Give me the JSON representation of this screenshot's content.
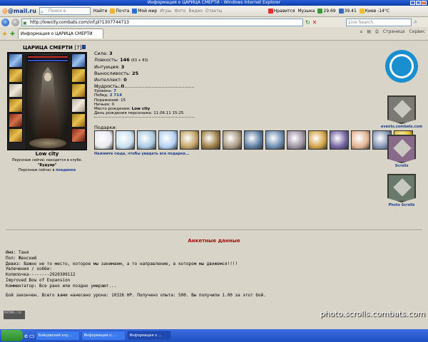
{
  "window": {
    "title": "Информация о ЦАРИЦА СМЕРТИ - Windows Internet Explorer"
  },
  "mail_toolbar": {
    "logo": "@mail.ru",
    "search_placeholder": "Поиск в Интернете",
    "find": "Найти",
    "items": [
      "Почта",
      "Мой мир",
      "Игры",
      "Фото",
      "Видео",
      "Ответы"
    ],
    "likes": "Нравится",
    "music": "Музыка",
    "usd": "29.69",
    "eur": "39.41",
    "weather": "Киев -14°C"
  },
  "nav": {
    "url": "http://lowcity.combats.com/inf.pl?1307744713",
    "live_search_placeholder": "Live Search"
  },
  "tab": {
    "title": "Информация о ЦАРИЦА СМЕРТИ",
    "tools": [
      "Страница",
      "Сервис"
    ]
  },
  "character": {
    "name": "ЦАРИЦА СМЕРТИ",
    "level": "[7]",
    "city": "Low city",
    "location_note": "Персонаж сейчас находится в клубе.",
    "club_room": "\"Будуар\"",
    "fight_prefix": "Персонаж сейчас в",
    "fight_link": "поединке"
  },
  "stats": [
    {
      "label": "Сила:",
      "value": "3",
      "bonus": ""
    },
    {
      "label": "Ловкость:",
      "value": "146",
      "bonus": "(63 + 83)"
    },
    {
      "label": "Интуиция:",
      "value": "3",
      "bonus": ""
    },
    {
      "label": "Выносливость:",
      "value": "25",
      "bonus": ""
    },
    {
      "label": "Интеллект:",
      "value": "0",
      "bonus": ""
    },
    {
      "label": "Мудрость:",
      "value": "0",
      "bonus": ""
    }
  ],
  "details": {
    "level_label": "Уровень:",
    "level": "7",
    "wins_label": "Побед:",
    "wins": "2 714",
    "losses_label": "Поражений:",
    "losses": "15",
    "draws_label": "Ничьих:",
    "draws": "0",
    "birthplace_label": "Место рождения:",
    "birthplace": "Low city",
    "birthday_label": "День рождения персонажа:",
    "birthday": "11.06.11 15:25"
  },
  "gifts": {
    "label": "Подарки:",
    "link": "Нажмите сюда, чтобы увидеть все подарки...",
    "colors": [
      "#e8e8f0",
      "#c8e0f0",
      "#a8c8e0",
      "#b0d0f0",
      "#c0a060",
      "#9a7a40",
      "#a89880",
      "#5a7aa0",
      "#6a8ab0",
      "#9a90a0",
      "#d0a040",
      "#7060a0",
      "#e0b090",
      "#8090b0",
      "#e8c030"
    ]
  },
  "sidebar": {
    "events_label": "events.combats.com",
    "scrolls_label": "Scrolls",
    "photo_scrolls_label": "Photo Scrolls"
  },
  "profile": {
    "section_title": "Анкетные данные",
    "lines": [
      "Имя: Таня",
      "Пол: Женский",
      "Девиз: Важно не то место, которое мы занимаем, а то направление, в котором мы движемся!!!!",
      "Увлечения / хобби:",
      "Копилочка--------2920309112",
      "Improved Bow of Expansion",
      "Комментатор: Все рано или поздно умирают..."
    ],
    "fight_summary": "Бой закончен. Всего вами нанесено урона: 10326 HP. Получено опыта: 500. Вы получили 1.00 за этот бой."
  },
  "badge": {
    "text": "RATING / 10"
  },
  "taskbar": {
    "buttons": [
      "Бойцовский клу...",
      "Информация о ...",
      "Информация о ..."
    ]
  },
  "watermark": "photo.scrolls.combats.com"
}
